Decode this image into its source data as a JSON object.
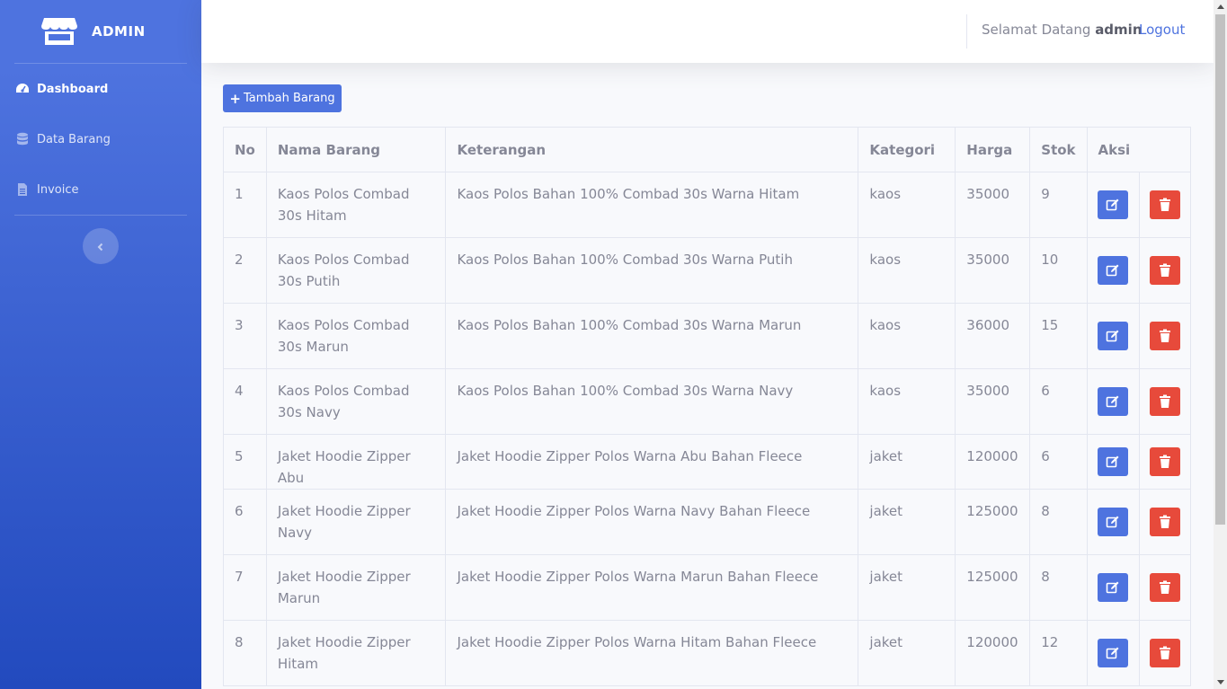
{
  "sidebar": {
    "brand": "ADMIN",
    "items": [
      {
        "label": "Dashboard",
        "icon": "tachometer-icon",
        "active": true
      },
      {
        "label": "Data Barang",
        "icon": "database-icon"
      },
      {
        "label": "Invoice",
        "icon": "file-icon"
      }
    ]
  },
  "topbar": {
    "welcome": "Selamat Datang",
    "user": "admin",
    "logout": "Logout"
  },
  "main": {
    "add_button": "Tambah Barang",
    "columns": [
      "No",
      "Nama Barang",
      "Keterangan",
      "Kategori",
      "Harga",
      "Stok",
      "Aksi"
    ],
    "rows": [
      {
        "no": "1",
        "nama": "Kaos Polos Combad 30s Hitam",
        "ket": "Kaos Polos Bahan 100% Combad 30s Warna Hitam",
        "kat": "kaos",
        "harga": "35000",
        "stok": "9"
      },
      {
        "no": "2",
        "nama": "Kaos Polos Combad 30s Putih",
        "ket": "Kaos Polos Bahan 100% Combad 30s Warna Putih",
        "kat": "kaos",
        "harga": "35000",
        "stok": "10"
      },
      {
        "no": "3",
        "nama": "Kaos Polos Combad 30s Marun",
        "ket": "Kaos Polos Bahan 100% Combad 30s Warna Marun",
        "kat": "kaos",
        "harga": "36000",
        "stok": "15"
      },
      {
        "no": "4",
        "nama": "Kaos Polos Combad 30s Navy",
        "ket": "Kaos Polos Bahan 100% Combad 30s Warna Navy",
        "kat": "kaos",
        "harga": "35000",
        "stok": "6"
      },
      {
        "no": "5",
        "nama": "Jaket Hoodie Zipper Abu",
        "ket": "Jaket Hoodie Zipper Polos Warna Abu Bahan Fleece",
        "kat": "jaket",
        "harga": "120000",
        "stok": "6"
      },
      {
        "no": "6",
        "nama": "Jaket Hoodie Zipper Navy",
        "ket": "Jaket Hoodie Zipper Polos Warna Navy Bahan Fleece",
        "kat": "jaket",
        "harga": "125000",
        "stok": "8"
      },
      {
        "no": "7",
        "nama": "Jaket Hoodie Zipper Marun",
        "ket": "Jaket Hoodie Zipper Polos Warna Marun Bahan Fleece",
        "kat": "jaket",
        "harga": "125000",
        "stok": "8"
      },
      {
        "no": "8",
        "nama": "Jaket Hoodie Zipper Hitam",
        "ket": "Jaket Hoodie Zipper Polos Warna Hitam Bahan Fleece",
        "kat": "jaket",
        "harga": "120000",
        "stok": "12"
      }
    ]
  },
  "colors": {
    "primary": "#4e73df",
    "danger": "#e74a3b",
    "text": "#858796"
  }
}
